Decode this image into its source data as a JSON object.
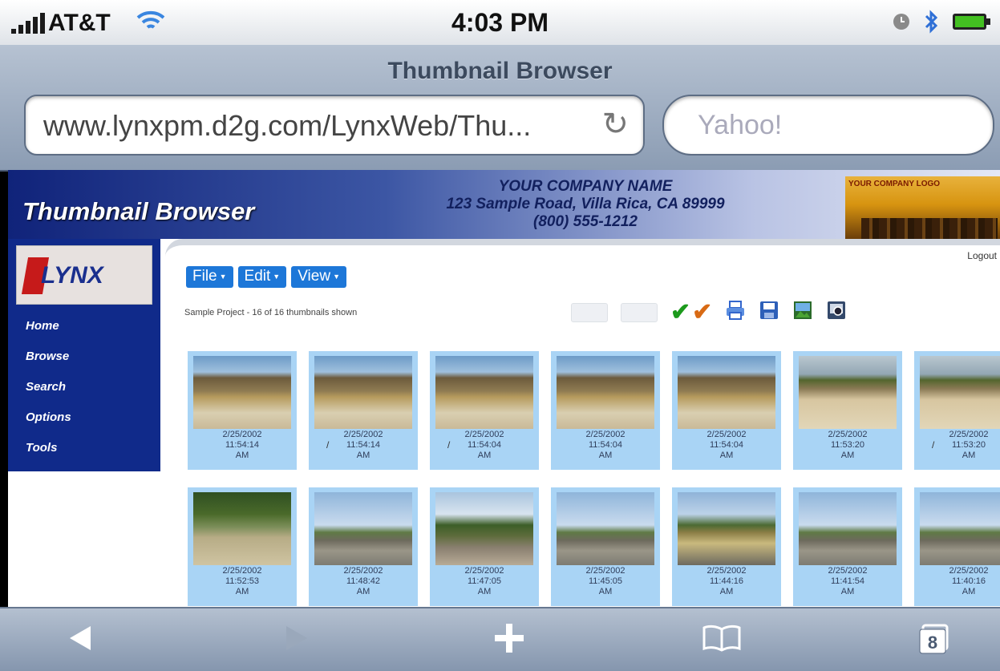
{
  "status_bar": {
    "carrier": "AT&T",
    "time": "4:03 PM"
  },
  "browser": {
    "page_title": "Thumbnail Browser",
    "url": "www.lynxpm.d2g.com/LynxWeb/Thu...",
    "search_placeholder": "Yahoo!",
    "tabs_count": "8"
  },
  "site": {
    "app_title": "Thumbnail Browser",
    "company_name": "YOUR COMPANY NAME",
    "company_address": "123 Sample Road, Villa Rica, CA 89999",
    "company_phone": "(800) 555-1212",
    "company_logo_text": "YOUR COMPANY LOGO",
    "side_logo_text": "LYNX",
    "logout": "Logout",
    "nav": [
      "Home",
      "Browse",
      "Search",
      "Options",
      "Tools"
    ],
    "menu": [
      "File",
      "Edit",
      "View"
    ],
    "status_text": "Sample Project - 16 of 16 thumbnails shown",
    "thumbnails": [
      {
        "date": "2/25/2002",
        "time": "11:54:14",
        "ampm": "AM",
        "scene": "building-dozer",
        "mark": ""
      },
      {
        "date": "2/25/2002",
        "time": "11:54:14",
        "ampm": "AM",
        "scene": "building-dozer",
        "mark": "/"
      },
      {
        "date": "2/25/2002",
        "time": "11:54:04",
        "ampm": "AM",
        "scene": "building-dozer",
        "mark": "/"
      },
      {
        "date": "2/25/2002",
        "time": "11:54:04",
        "ampm": "AM",
        "scene": "building-dozer",
        "mark": ""
      },
      {
        "date": "2/25/2002",
        "time": "11:54:04",
        "ampm": "AM",
        "scene": "building-dozer",
        "mark": ""
      },
      {
        "date": "2/25/2002",
        "time": "11:53:20",
        "ampm": "AM",
        "scene": "dozer-dirt",
        "mark": ""
      },
      {
        "date": "2/25/2002",
        "time": "11:53:20",
        "ampm": "AM",
        "scene": "dozer-dirt",
        "mark": "/"
      },
      {
        "date": "2/25/2002",
        "time": "11:52:53",
        "ampm": "AM",
        "scene": "dozer-trees",
        "mark": ""
      },
      {
        "date": "2/25/2002",
        "time": "11:48:42",
        "ampm": "AM",
        "scene": "road-sky",
        "mark": ""
      },
      {
        "date": "2/25/2002",
        "time": "11:47:05",
        "ampm": "AM",
        "scene": "road-truck",
        "mark": ""
      },
      {
        "date": "2/25/2002",
        "time": "11:45:05",
        "ampm": "AM",
        "scene": "road-sky",
        "mark": ""
      },
      {
        "date": "2/25/2002",
        "time": "11:44:16",
        "ampm": "AM",
        "scene": "excavator",
        "mark": ""
      },
      {
        "date": "2/25/2002",
        "time": "11:41:54",
        "ampm": "AM",
        "scene": "road-sky",
        "mark": ""
      },
      {
        "date": "2/25/2002",
        "time": "11:40:16",
        "ampm": "AM",
        "scene": "road-sky",
        "mark": ""
      }
    ]
  },
  "colors": {
    "accent": "#1d77d8",
    "nav_bg": "#102a8a",
    "thumb_bg": "#a9d4f5",
    "check_green": "#1c9a1c",
    "check_orange": "#d86a14"
  }
}
